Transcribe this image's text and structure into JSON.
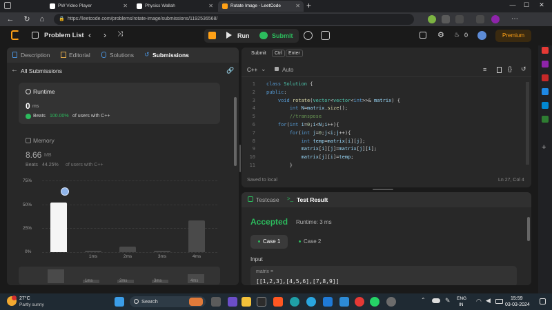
{
  "browser": {
    "tabs": [
      {
        "title": "PW Video Player",
        "favicon_color": "#ffffff"
      },
      {
        "title": "Physics Wallah",
        "favicon_color": "#ffffff"
      },
      {
        "title": "Rotate Image - LeetCode",
        "favicon_color": "#ffa116"
      }
    ],
    "url": "https://leetcode.com/problems/rotate-image/submissions/1192536568/",
    "window_controls": [
      "—",
      "☐",
      "✕"
    ]
  },
  "header": {
    "problem_list": "Problem List",
    "run": "Run",
    "submit": "Submit",
    "streak_count": "0",
    "premium": "Premium"
  },
  "left_panel": {
    "tabs": [
      "Description",
      "Editorial",
      "Solutions",
      "Submissions"
    ],
    "back_label": "All Submissions",
    "runtime": {
      "label": "Runtime",
      "value": "0",
      "unit": "ms",
      "beats_prefix": "Beats",
      "beats_value": "100.00%",
      "beats_suffix": "of users with C++"
    },
    "memory": {
      "label": "Memory",
      "value": "8.66",
      "unit": "MB",
      "beats_prefix": "Beats",
      "beats_value": "44.25%",
      "beats_suffix": "of users with C++"
    }
  },
  "chart_data": {
    "type": "bar",
    "categories": [
      "0ms",
      "1ms",
      "2ms",
      "3ms",
      "4ms"
    ],
    "tick_labels": [
      "",
      "1ms",
      "2ms",
      "3ms",
      "4ms"
    ],
    "values": [
      52,
      1.5,
      6,
      1.5,
      33
    ],
    "selected_index": 0,
    "y_ticks": [
      "75%",
      "50%",
      "25%",
      "0%"
    ],
    "ylim": [
      0,
      75
    ]
  },
  "editor": {
    "tabs": [
      "Submit",
      "Ctrl",
      "Enter"
    ],
    "language": "C++",
    "mode": "Auto",
    "status": "Saved to local",
    "cursor": "Ln 27, Col 4",
    "lines": [
      {
        "n": "1",
        "html": "<span class='kw'>class</span> <span class='ty'>Solution</span> {"
      },
      {
        "n": "2",
        "html": "<span class='kw'>public</span>:"
      },
      {
        "n": "3",
        "html": "    <span class='kw'>void</span> <span class='fn'>rotate</span>(<span class='ty'>vector</span>&lt;<span class='ty'>vector</span>&lt;<span class='kw'>int</span>&gt;&gt;&amp; <span class='vr'>matrix</span>) {"
      },
      {
        "n": "4",
        "html": "        <span class='kw'>int</span> <span class='vr'>N</span>=<span class='vr'>matrix</span>.<span class='fn'>size</span>();"
      },
      {
        "n": "5",
        "html": "        <span class='cm'>//transpose</span>"
      },
      {
        "n": "6",
        "html": "    <span class='kw'>for</span>(<span class='kw'>int</span> <span class='vr'>i</span>=<span class='nm'>0</span>;<span class='vr'>i</span>&lt;<span class='vr'>N</span>;<span class='vr'>i</span>++){"
      },
      {
        "n": "7",
        "html": "        <span class='kw'>for</span>(<span class='kw'>int</span> <span class='vr'>j</span>=<span class='nm'>0</span>;<span class='vr'>j</span>&lt;<span class='vr'>i</span>;<span class='vr'>j</span>++){"
      },
      {
        "n": "8",
        "html": "            <span class='kw'>int</span> <span class='vr'>temp</span>=<span class='vr'>matrix</span>[<span class='vr'>i</span>][<span class='vr'>j</span>];"
      },
      {
        "n": "9",
        "html": "            <span class='vr'>matrix</span>[<span class='vr'>i</span>][<span class='vr'>j</span>]=<span class='vr'>matrix</span>[<span class='vr'>j</span>][<span class='vr'>i</span>];"
      },
      {
        "n": "10",
        "html": "            <span class='vr'>matrix</span>[<span class='vr'>j</span>][<span class='vr'>i</span>]=<span class='vr'>temp</span>;"
      },
      {
        "n": "11",
        "html": "        }"
      }
    ]
  },
  "result_panel": {
    "tabs": [
      "Testcase",
      "Test Result"
    ],
    "verdict": "Accepted",
    "runtime_text": "Runtime: 3 ms",
    "cases": [
      "Case 1",
      "Case 2"
    ],
    "input_label": "Input",
    "param_name": "matrix =",
    "param_value": "[[1,2,3],[4,5,6],[7,8,9]]"
  },
  "taskbar": {
    "weather_temp": "27°C",
    "weather_desc": "Partly sunny",
    "search_placeholder": "Search",
    "lang_top": "ENG",
    "lang_bottom": "IN",
    "time": "15:59",
    "date": "03-03-2024"
  }
}
